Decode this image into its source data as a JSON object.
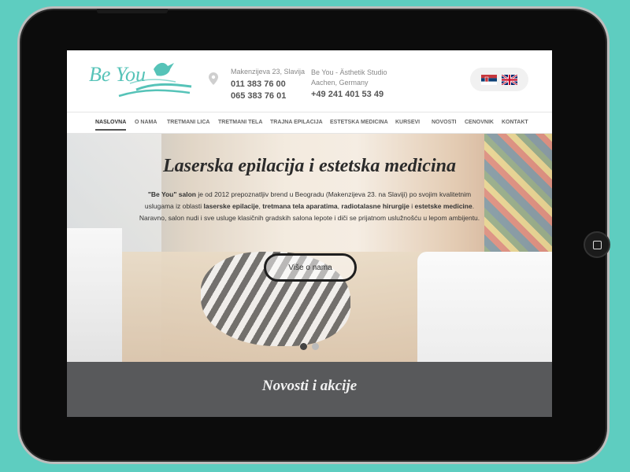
{
  "logo": {
    "text": "Be You"
  },
  "contact": {
    "address_rs": "Makenzijeva 23, Slavija",
    "phone_1": "011 383 76 00",
    "phone_2": "065 383 76 01",
    "studio_name": "Be You - Ästhetik Studio",
    "address_de": "Aachen, Germany",
    "phone_de": "+49 241 401 53 49"
  },
  "languages": [
    "serbian-flag",
    "uk-flag"
  ],
  "nav": {
    "items": [
      "NASLOVNA",
      "O NAMA",
      "TRETMANI LICA",
      "TRETMANI TELA",
      "TRAJNA EPILACIJA",
      "ESTETSKA MEDICINA",
      "KURSEVI",
      "NOVOSTI",
      "CENOVNIK",
      "KONTAKT"
    ],
    "active": "NASLOVNA"
  },
  "hero": {
    "title": "Laserska epilacija i estetska medicina",
    "text_parts": [
      "\"Be You\" salon",
      " je od 2012 prepoznatljiv brend u Beogradu (Makenzijeva 23. na Slaviji) po svojim kvalitetnim uslugama iz oblasti ",
      "laserske epilacije",
      ", ",
      "tretmana tela aparatima",
      ", ",
      "radiotalasne hirurgije",
      " i ",
      "estetske medicine",
      ". Naravno, salon nudi i sve usluge klasičnih gradskih salona lepote i diči se prijatnom uslužnošću u lepom ambijentu."
    ],
    "button": "Više o nama",
    "slides": 2,
    "active_slide": 1
  },
  "news": {
    "title": "Novosti i akcije"
  },
  "colors": {
    "background": "#5ecdc0",
    "brand": "#56c3b8",
    "news_bar": "#58595b"
  }
}
